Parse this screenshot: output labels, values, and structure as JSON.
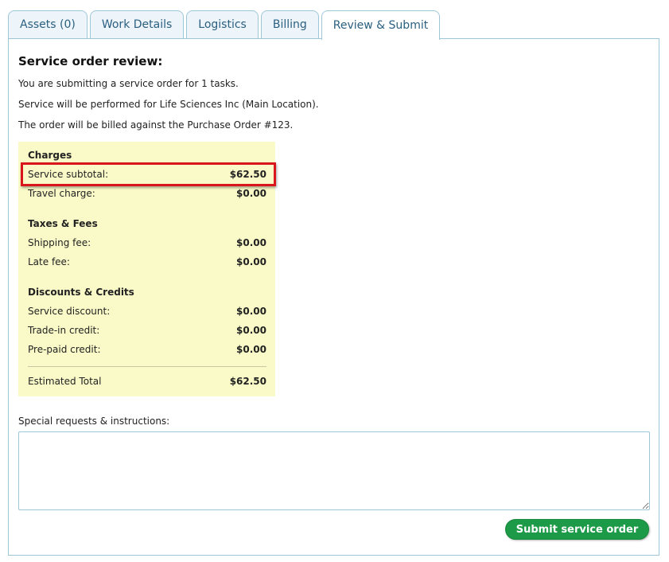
{
  "tabs": [
    {
      "label": "Assets (0)"
    },
    {
      "label": "Work Details"
    },
    {
      "label": "Logistics"
    },
    {
      "label": "Billing"
    },
    {
      "label": "Review & Submit",
      "active": true
    }
  ],
  "review": {
    "title": "Service order review:",
    "lines": [
      "You are submitting a service order for 1 tasks.",
      "Service will be performed for Life Sciences Inc (Main Location).",
      "The order will be billed against the Purchase Order #123."
    ]
  },
  "summary": {
    "charges_label": "Charges",
    "charges": [
      {
        "label": "Service subtotal:",
        "value": "$62.50"
      },
      {
        "label": "Travel charge:",
        "value": "$0.00"
      }
    ],
    "taxes_label": "Taxes & Fees",
    "taxes": [
      {
        "label": "Shipping fee:",
        "value": "$0.00"
      },
      {
        "label": "Late fee:",
        "value": "$0.00"
      }
    ],
    "discounts_label": "Discounts & Credits",
    "discounts": [
      {
        "label": "Service discount:",
        "value": "$0.00"
      },
      {
        "label": "Trade-in credit:",
        "value": "$0.00"
      },
      {
        "label": "Pre-paid credit:",
        "value": "$0.00"
      }
    ],
    "total": {
      "label": "Estimated Total",
      "value": "$62.50"
    }
  },
  "notes": {
    "label": "Special requests & instructions:",
    "value": "",
    "placeholder": ""
  },
  "actions": {
    "submit_label": "Submit service order"
  },
  "colors": {
    "accent": "#2a5f80",
    "summary_bg": "#fafac8",
    "highlight": "#d9161b",
    "submit_bg": "#1d9a47"
  }
}
